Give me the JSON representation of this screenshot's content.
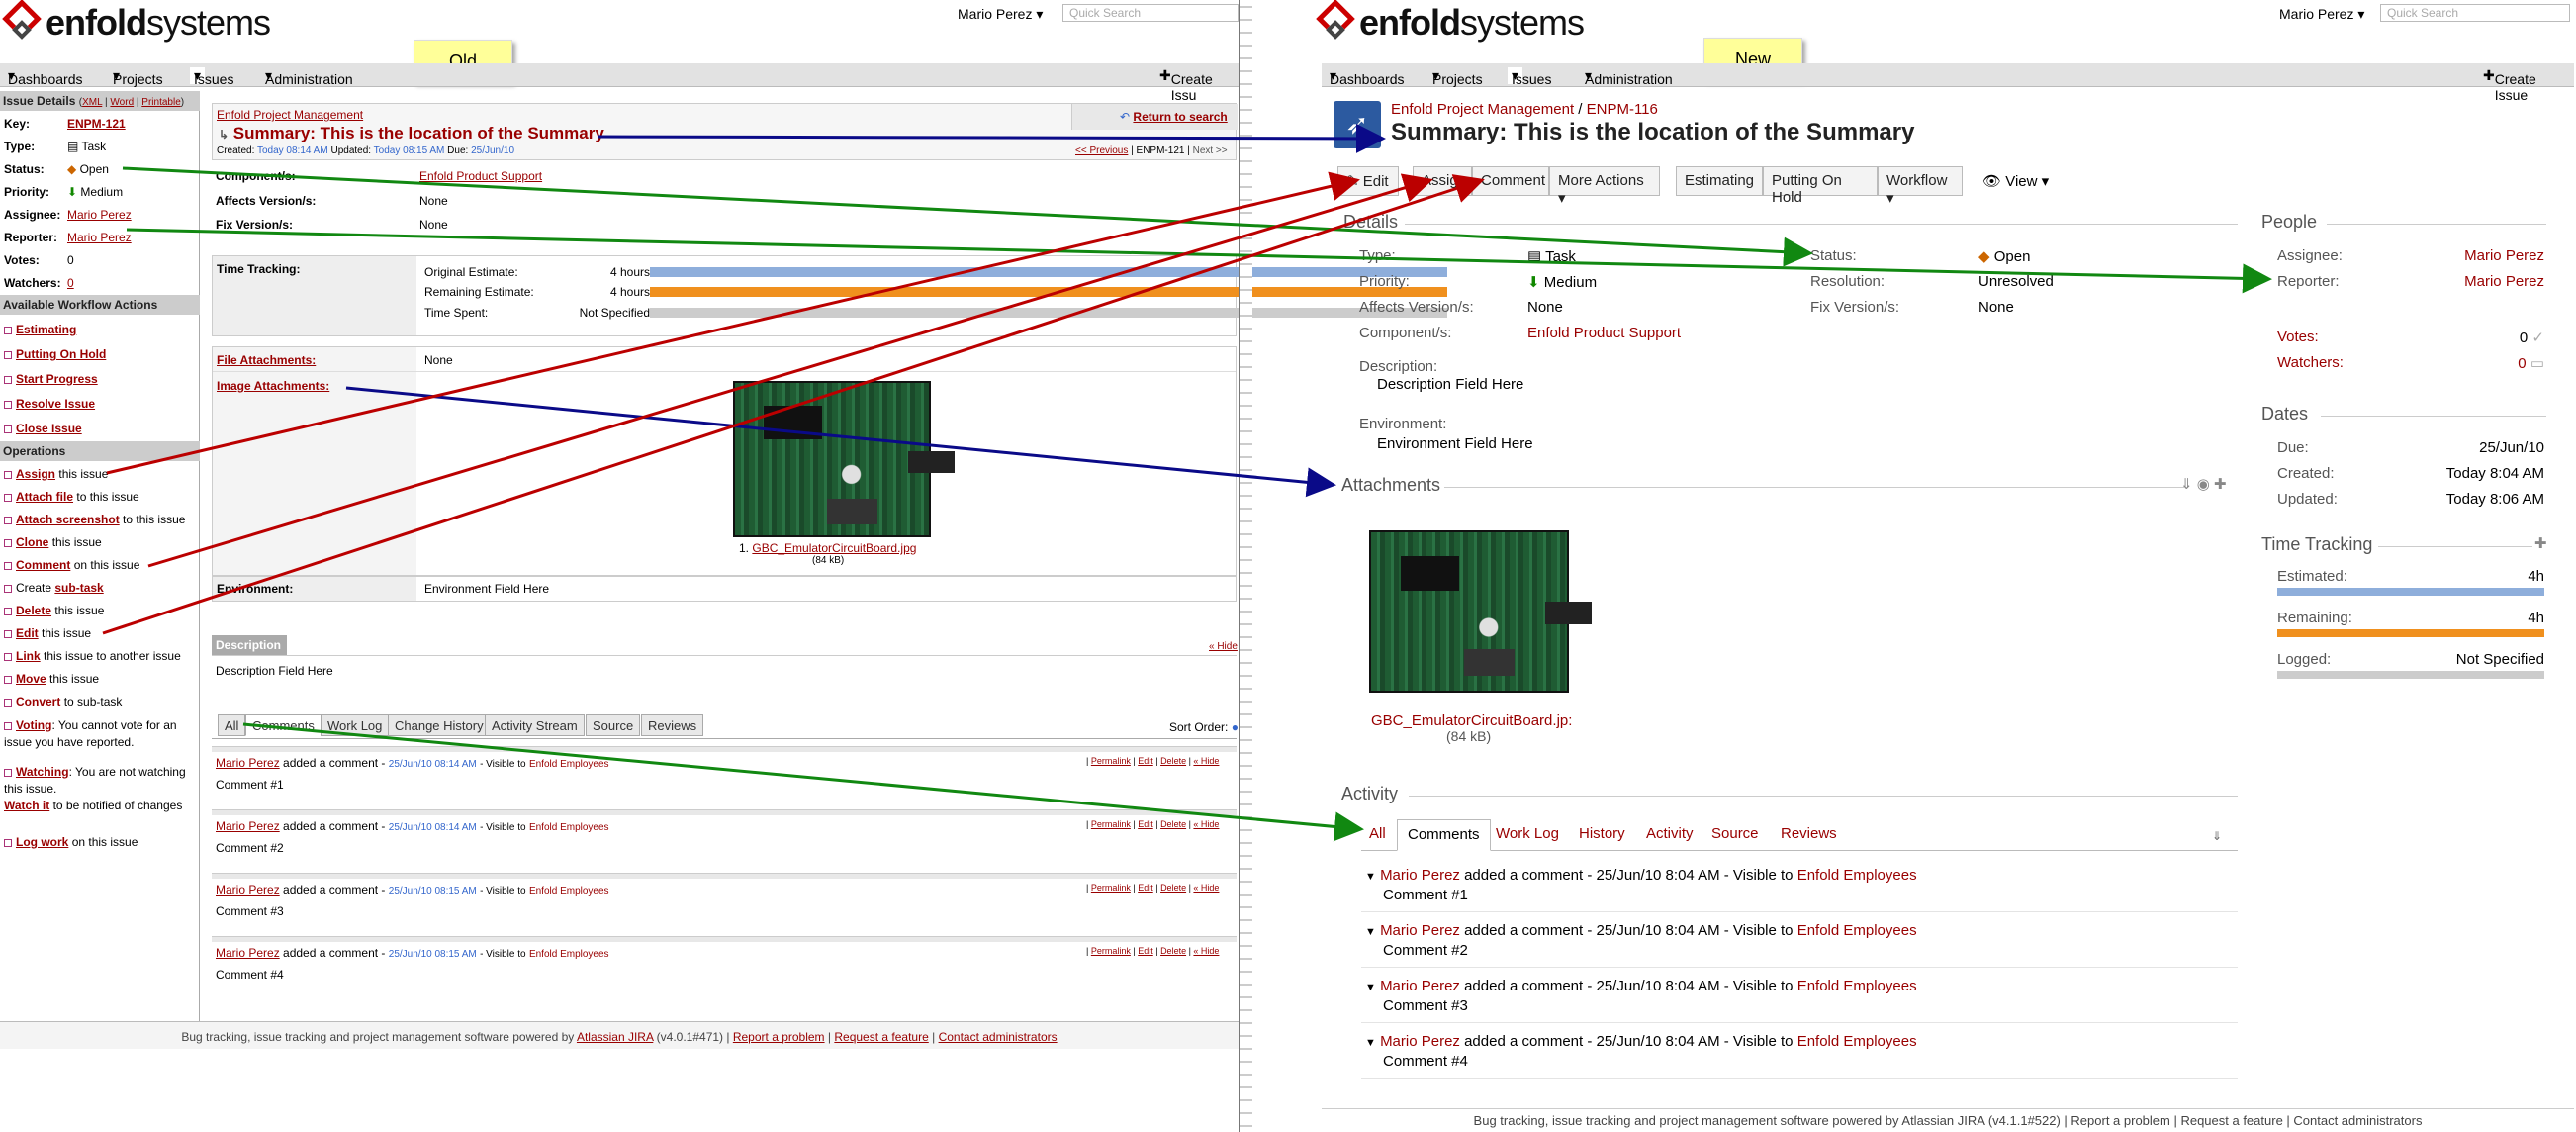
{
  "old": {
    "sticky": "Old",
    "user": "Mario Perez",
    "search_placeholder": "Quick Search",
    "nav": {
      "dashboards": "Dashboards",
      "projects": "Projects",
      "issues": "Issues",
      "administration": "Administration",
      "create": "Create Issu"
    },
    "sidebar": {
      "issue_details": "Issue Details",
      "xml": "XML",
      "word": "Word",
      "printable": "Printable",
      "key_l": "Key:",
      "key_v": "ENPM-121",
      "type_l": "Type:",
      "type_v": "Task",
      "status_l": "Status:",
      "status_v": "Open",
      "priority_l": "Priority:",
      "priority_v": "Medium",
      "assignee_l": "Assignee:",
      "assignee_v": "Mario Perez",
      "reporter_l": "Reporter:",
      "reporter_v": "Mario Perez",
      "votes_l": "Votes:",
      "votes_v": "0",
      "watchers_l": "Watchers:",
      "watchers_v": "0",
      "workflow_h": "Available Workflow Actions",
      "wf": [
        "Estimating",
        "Putting On Hold",
        "Start Progress",
        "Resolve Issue",
        "Close Issue"
      ],
      "ops_h": "Operations",
      "op_assign": "Assign",
      "op_assign_s": "this issue",
      "op_attach": "Attach file",
      "op_attach_s": "to this issue",
      "op_screenshot": "Attach screenshot",
      "op_screenshot_s": "to this issue",
      "op_clone": "Clone",
      "op_clone_s": "this issue",
      "op_comment": "Comment",
      "op_comment_s": "on this issue",
      "op_create": "Create",
      "op_subtask": "sub-task",
      "op_delete": "Delete",
      "op_delete_s": "this issue",
      "op_edit": "Edit",
      "op_edit_s": "this issue",
      "op_link": "Link",
      "op_link_s": "this issue to another issue",
      "op_move": "Move",
      "op_move_s": "this issue",
      "op_convert": "Convert",
      "op_convert_s": "to sub-task",
      "op_voting": "Voting",
      "op_voting_s": "You cannot vote for an issue you have reported.",
      "op_watching": "Watching",
      "op_watching_s": "You are not watching this issue.",
      "op_watchit": "Watch it",
      "op_watchit_s": "to be notified of changes",
      "op_logwork": "Log work",
      "op_logwork_s": "on this issue"
    },
    "main": {
      "project": "Enfold Project Management",
      "summary": "Summary:  This is the location of the Summary",
      "created_l": "Created:",
      "created_v": "Today 08:14 AM",
      "updated_l": "Updated:",
      "updated_v": "Today 08:15 AM",
      "due_l": "Due:",
      "due_v": "25/Jun/10",
      "return": "Return to search",
      "prev": "<< Previous",
      "cur": "ENPM-121",
      "next": "Next >>",
      "components_l": "Component/s:",
      "components_v": "Enfold Product Support",
      "affects_l": "Affects Version/s:",
      "affects_v": "None",
      "fix_l": "Fix Version/s:",
      "fix_v": "None",
      "tt_l": "Time Tracking:",
      "orig_l": "Original Estimate:",
      "orig_v": "4 hours",
      "rem_l": "Remaining Estimate:",
      "rem_v": "4 hours",
      "spent_l": "Time Spent:",
      "spent_v": "Not Specified",
      "file_l": "File Attachments:",
      "file_v": "None",
      "img_l": "Image Attachments:",
      "img_name": "GBC_EmulatorCircuitBoard.jpg",
      "img_idx": "1.",
      "img_size": "(84 kB)",
      "env_l": "Environment:",
      "env_v": "Environment Field Here",
      "desc_h": "Description",
      "hide": "« Hide",
      "desc_v": "Description Field Here",
      "tabs": [
        "All",
        "Comments",
        "Work Log",
        "Change History",
        "Activity Stream",
        "Source",
        "Reviews"
      ],
      "sort": "Sort Order:",
      "permalink": "Permalink",
      "edit": "Edit",
      "delete": "Delete",
      "comments": [
        {
          "author": "Mario Perez",
          "verb": "added a comment -",
          "date": "25/Jun/10 08:14 AM",
          "vis": "- Visible to",
          "group": "Enfold Employees",
          "text": "Comment #1"
        },
        {
          "author": "Mario Perez",
          "verb": "added a comment -",
          "date": "25/Jun/10 08:14 AM",
          "vis": "- Visible to",
          "group": "Enfold Employees",
          "text": "Comment #2"
        },
        {
          "author": "Mario Perez",
          "verb": "added a comment -",
          "date": "25/Jun/10 08:15 AM",
          "vis": "- Visible to",
          "group": "Enfold Employees",
          "text": "Comment #3"
        },
        {
          "author": "Mario Perez",
          "verb": "added a comment -",
          "date": "25/Jun/10 08:15 AM",
          "vis": "- Visible to",
          "group": "Enfold Employees",
          "text": "Comment #4"
        }
      ],
      "footer_a": "Bug tracking, issue tracking and project management software powered by",
      "footer_jira": "Atlassian JIRA",
      "footer_v": "(v4.0.1#471)",
      "footer_report": "Report a problem",
      "footer_feature": "Request a feature",
      "footer_contact": "Contact administrators"
    }
  },
  "new": {
    "sticky": "New",
    "user": "Mario Perez",
    "search_placeholder": "Quick Search",
    "nav": {
      "dashboards": "Dashboards",
      "projects": "Projects",
      "issues": "Issues",
      "administration": "Administration",
      "create": "Create Issue"
    },
    "project": "Enfold Project Management",
    "sep": "/",
    "key": "ENPM-116",
    "summary": "Summary:  This is the location of the Summary",
    "buttons": {
      "edit": "Edit",
      "assign": "Assign",
      "comment": "Comment",
      "more": "More Actions",
      "estimating": "Estimating",
      "hold": "Putting On Hold",
      "workflow": "Workflow",
      "view": "View"
    },
    "details_h": "Details",
    "type_l": "Type:",
    "type_v": "Task",
    "priority_l": "Priority:",
    "priority_v": "Medium",
    "affects_l": "Affects Version/s:",
    "affects_v": "None",
    "components_l": "Component/s:",
    "components_v": "Enfold Product Support",
    "status_l": "Status:",
    "status_v": "Open",
    "resolution_l": "Resolution:",
    "resolution_v": "Unresolved",
    "fix_l": "Fix Version/s:",
    "fix_v": "None",
    "desc_l": "Description:",
    "desc_v": "Description Field Here",
    "env_l": "Environment:",
    "env_v": "Environment Field Here",
    "attach_h": "Attachments",
    "img_name": "GBC_EmulatorCircuitBoard.jp:",
    "img_size": "(84 kB)",
    "activity_h": "Activity",
    "tabs": [
      "All",
      "Comments",
      "Work Log",
      "History",
      "Activity",
      "Source",
      "Reviews"
    ],
    "comments": [
      {
        "author": "Mario Perez",
        "meta": "added a comment - 25/Jun/10 8:04 AM - Visible to",
        "group": "Enfold Employees",
        "text": "Comment #1"
      },
      {
        "author": "Mario Perez",
        "meta": "added a comment - 25/Jun/10 8:04 AM - Visible to",
        "group": "Enfold Employees",
        "text": "Comment #2"
      },
      {
        "author": "Mario Perez",
        "meta": "added a comment - 25/Jun/10 8:04 AM - Visible to",
        "group": "Enfold Employees",
        "text": "Comment #3"
      },
      {
        "author": "Mario Perez",
        "meta": "added a comment - 25/Jun/10 8:04 AM - Visible to",
        "group": "Enfold Employees",
        "text": "Comment #4"
      }
    ],
    "people_h": "People",
    "assignee_l": "Assignee:",
    "assignee_v": "Mario Perez",
    "reporter_l": "Reporter:",
    "reporter_v": "Mario Perez",
    "votes_l": "Votes:",
    "votes_v": "0",
    "watchers_l": "Watchers:",
    "watchers_v": "0",
    "dates_h": "Dates",
    "due_l": "Due:",
    "due_v": "25/Jun/10",
    "created_l": "Created:",
    "created_v": "Today 8:04 AM",
    "updated_l": "Updated:",
    "updated_v": "Today 8:06 AM",
    "tt_h": "Time Tracking",
    "est_l": "Estimated:",
    "est_v": "4h",
    "rem_l": "Remaining:",
    "rem_v": "4h",
    "logged_l": "Logged:",
    "logged_v": "Not Specified",
    "footer": "Bug tracking, issue tracking and project management software powered by Atlassian JIRA (v4.1.1#522) | Report a problem | Request a feature | Contact administrators"
  },
  "colors": {
    "link": "#990000",
    "bar_blue": "#8eaedb",
    "bar_orange": "#f0901e",
    "bar_grey": "#cccccc",
    "arrow_red": "#bb0000",
    "arrow_blue": "#0a0a88",
    "arrow_green": "#118811"
  }
}
